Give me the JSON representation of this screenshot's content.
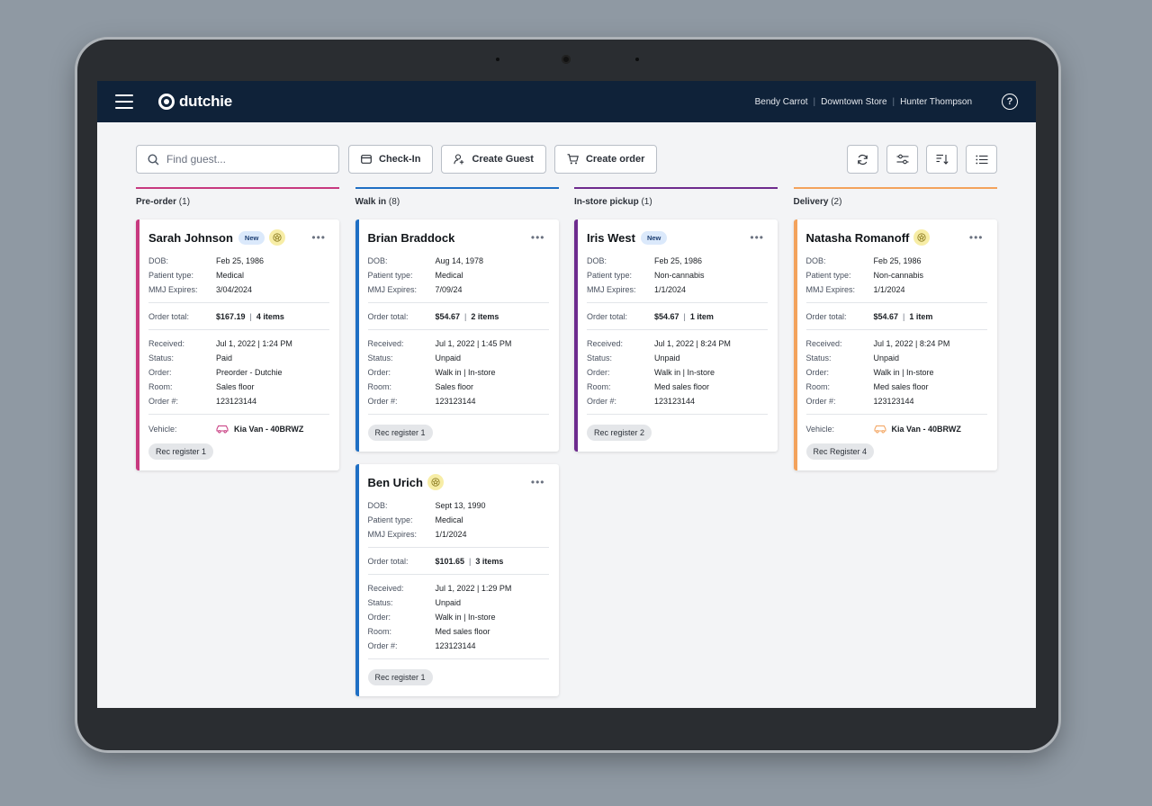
{
  "header": {
    "brand": "dutchie",
    "user": "Bendy Carrot",
    "store": "Downtown Store",
    "employee": "Hunter Thompson",
    "help": "?"
  },
  "toolbar": {
    "search_placeholder": "Find guest...",
    "checkin_label": "Check-In",
    "create_guest_label": "Create Guest",
    "create_order_label": "Create order",
    "icon_buttons": [
      "refresh-icon",
      "filter-icon",
      "sort-icon",
      "list-view-icon"
    ]
  },
  "colors": {
    "preorder": "#c7397f",
    "walkin": "#1f6fc4",
    "instore": "#6e2b8e",
    "delivery": "#f3a25c",
    "topbar": "#0f2239"
  },
  "columns": [
    {
      "title": "Pre-order",
      "count": "(1)",
      "cards": [
        {
          "name": "Sarah Johnson",
          "badge": "New",
          "dob_label": "DOB:",
          "dob": "Feb 25, 1986",
          "ptype_label": "Patient type:",
          "ptype": "Medical",
          "mmj_label": "MMJ Expires:",
          "mmj": "3/04/2024",
          "total_label": "Order total:",
          "total": "$167.19",
          "items": "4 items",
          "received_label": "Received:",
          "received": "Jul 1, 2022 | 1:24 PM",
          "status_label": "Status:",
          "status": "Paid",
          "order_label": "Order:",
          "order": "Preorder - Dutchie",
          "room_label": "Room:",
          "room": "Sales floor",
          "ordernum_label": "Order #:",
          "ordernum": "123123144",
          "vehicle_label": "Vehicle:",
          "vehicle": "Kia Van - 40BRWZ",
          "register": "Rec register 1"
        }
      ]
    },
    {
      "title": "Walk in",
      "count": "(8)",
      "cards": [
        {
          "name": "Brian Braddock",
          "dob_label": "DOB:",
          "dob": "Aug 14, 1978",
          "ptype_label": "Patient type:",
          "ptype": "Medical",
          "mmj_label": "MMJ Expires:",
          "mmj": "7/09/24",
          "total_label": "Order total:",
          "total": "$54.67",
          "items": "2 items",
          "received_label": "Received:",
          "received": "Jul 1, 2022 | 1:45 PM",
          "status_label": "Status:",
          "status": "Unpaid",
          "order_label": "Order:",
          "order": "Walk in | In-store",
          "room_label": "Room:",
          "room": "Sales floor",
          "ordernum_label": "Order #:",
          "ordernum": "123123144",
          "register": "Rec register 1"
        },
        {
          "name": "Ben Urich",
          "dob_label": "DOB:",
          "dob": "Sept 13, 1990",
          "ptype_label": "Patient type:",
          "ptype": "Medical",
          "mmj_label": "MMJ Expires:",
          "mmj": "1/1/2024",
          "total_label": "Order total:",
          "total": "$101.65",
          "items": "3 items",
          "received_label": "Received:",
          "received": "Jul 1, 2022 | 1:29 PM",
          "status_label": "Status:",
          "status": "Unpaid",
          "order_label": "Order:",
          "order": "Walk in | In-store",
          "room_label": "Room:",
          "room": "Med sales floor",
          "ordernum_label": "Order #:",
          "ordernum": "123123144",
          "register": "Rec register 1"
        }
      ]
    },
    {
      "title": "In-store pickup",
      "count": "(1)",
      "cards": [
        {
          "name": "Iris West",
          "badge": "New",
          "dob_label": "DOB:",
          "dob": "Feb 25, 1986",
          "ptype_label": "Patient type:",
          "ptype": "Non-cannabis",
          "mmj_label": "MMJ Expires:",
          "mmj": "1/1/2024",
          "total_label": "Order total:",
          "total": "$54.67",
          "items": "1 item",
          "received_label": "Received:",
          "received": "Jul 1, 2022 | 8:24 PM",
          "status_label": "Status:",
          "status": "Unpaid",
          "order_label": "Order:",
          "order": "Walk in | In-store",
          "room_label": "Room:",
          "room": "Med sales floor",
          "ordernum_label": "Order #:",
          "ordernum": "123123144",
          "register": "Rec register 2"
        }
      ]
    },
    {
      "title": "Delivery",
      "count": "(2)",
      "cards": [
        {
          "name": "Natasha Romanoff",
          "dob_label": "DOB:",
          "dob": "Feb 25, 1986",
          "ptype_label": "Patient type:",
          "ptype": "Non-cannabis",
          "mmj_label": "MMJ Expires:",
          "mmj": "1/1/2024",
          "total_label": "Order total:",
          "total": "$54.67",
          "items": "1 item",
          "received_label": "Received:",
          "received": "Jul 1, 2022 | 8:24 PM",
          "status_label": "Status:",
          "status": "Unpaid",
          "order_label": "Order:",
          "order": "Walk in | In-store",
          "room_label": "Room:",
          "room": "Med sales floor",
          "ordernum_label": "Order #:",
          "ordernum": "123123144",
          "vehicle_label": "Vehicle:",
          "vehicle": "Kia Van - 40BRWZ",
          "register": "Rec Register 4"
        }
      ]
    }
  ]
}
